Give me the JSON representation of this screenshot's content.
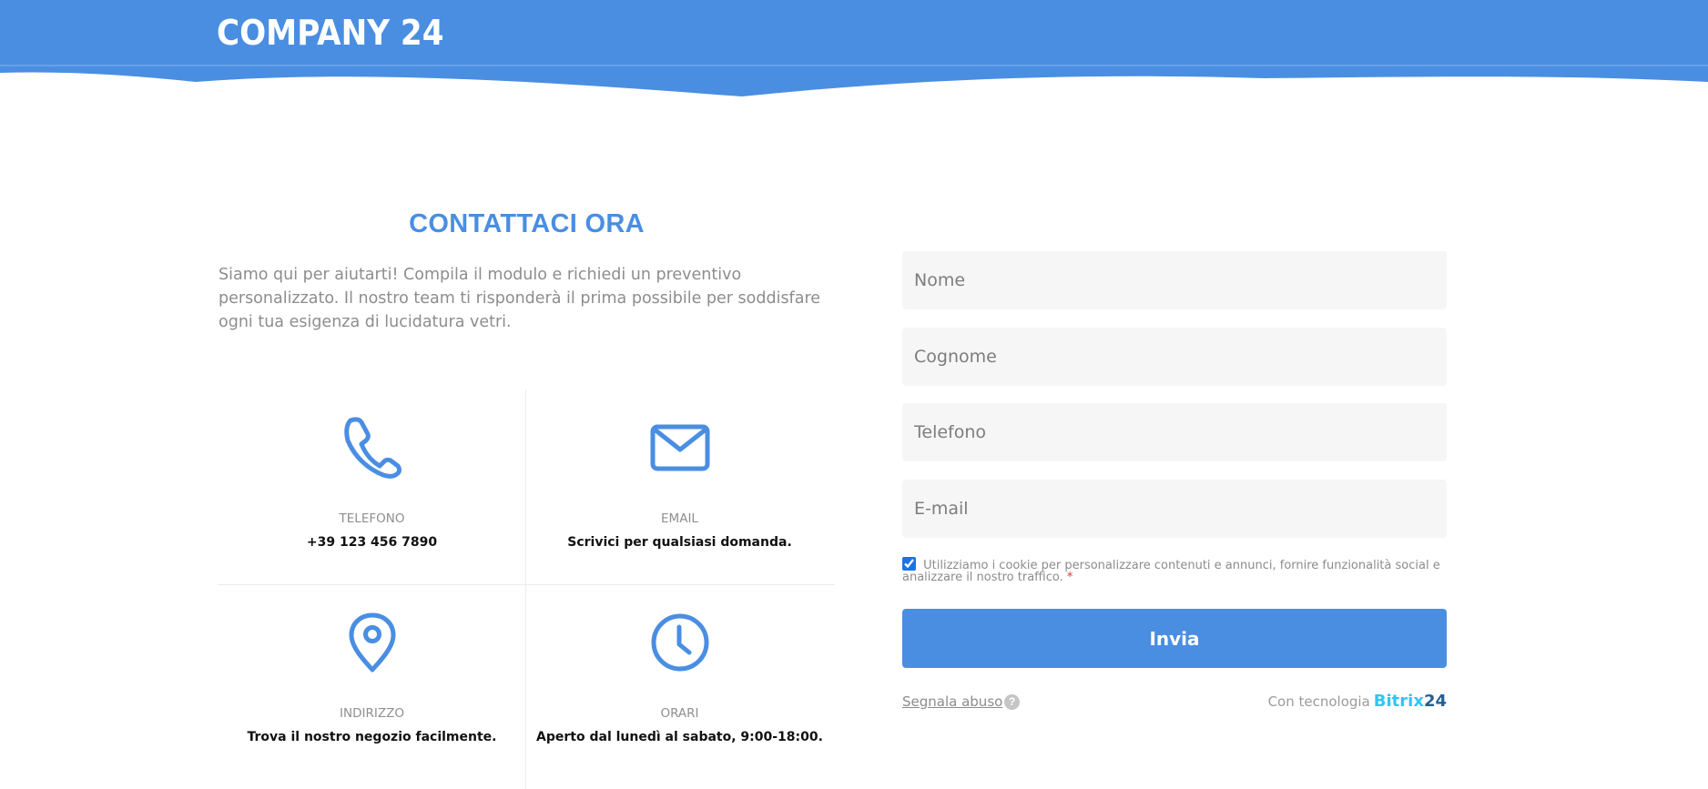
{
  "header": {
    "logo_text": "COMPANY 24",
    "color": "#4a8ee2"
  },
  "contact": {
    "title": "CONTATTACI ORA",
    "description": "Siamo qui per aiutarti! Compila il modulo e richiedi un preventivo personalizzato. Il nostro team ti risponderà il prima possibile per soddisfare ogni tua esigenza di lucidatura vetri.",
    "items": [
      {
        "icon": "phone-icon",
        "label": "TELEFONO",
        "value": "+39 123 456 7890"
      },
      {
        "icon": "envelope-icon",
        "label": "EMAIL",
        "value": "Scrivici per qualsiasi domanda."
      },
      {
        "icon": "map-pin-icon",
        "label": "INDIRIZZO",
        "value": "Trova il nostro negozio facilmente."
      },
      {
        "icon": "clock-icon",
        "label": "ORARI",
        "value": "Aperto dal lunedì al sabato, 9:00-18:00."
      }
    ]
  },
  "form": {
    "fields": [
      {
        "placeholder": "Nome"
      },
      {
        "placeholder": "Cognome"
      },
      {
        "placeholder": "Telefono"
      },
      {
        "placeholder": "E-mail"
      }
    ],
    "consent_text": "Utilizziamo i cookie per personalizzare contenuti e annunci, fornire funzionalità social e analizzare il nostro traffico.",
    "required_mark": "*",
    "consent_checked": true,
    "submit_label": "Invia",
    "abuse_link": "Segnala abuso",
    "help_icon": "?",
    "powered_by": "Con tecnologia",
    "brand_part1": "Bitrix",
    "brand_part2": "24"
  },
  "colors": {
    "accent": "#4a8ee2",
    "brand_light": "#2fc6f6",
    "brand_dark": "#215f98"
  }
}
